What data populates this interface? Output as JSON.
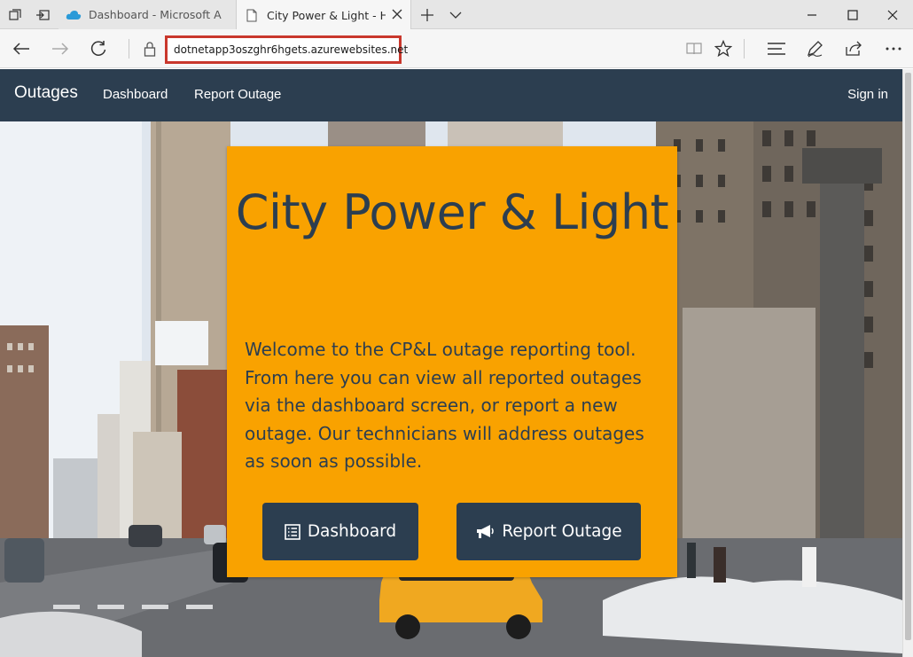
{
  "browser": {
    "tabs": [
      {
        "title": "Dashboard - Microsoft Azur",
        "icon": "cloud-icon",
        "active": false
      },
      {
        "title": "City Power & Light - Ho",
        "icon": "page-icon",
        "active": true
      }
    ],
    "url": "dotnetapp3oszghr6hgets.azurewebsites.net"
  },
  "navbar": {
    "brand": "Outages",
    "links": [
      "Dashboard",
      "Report Outage"
    ],
    "signin": "Sign in",
    "color": "#2c3e50"
  },
  "hero": {
    "title": "City Power & Light",
    "text": "Welcome to the CP&L outage reporting tool. From here you can view all reported outages via the dashboard screen, or report a new outage. Our technicians will address outages as soon as possible.",
    "buttons": [
      {
        "label": "Dashboard",
        "icon": "list-icon"
      },
      {
        "label": "Report Outage",
        "icon": "bullhorn-icon"
      }
    ],
    "card_color": "#f9a200"
  }
}
